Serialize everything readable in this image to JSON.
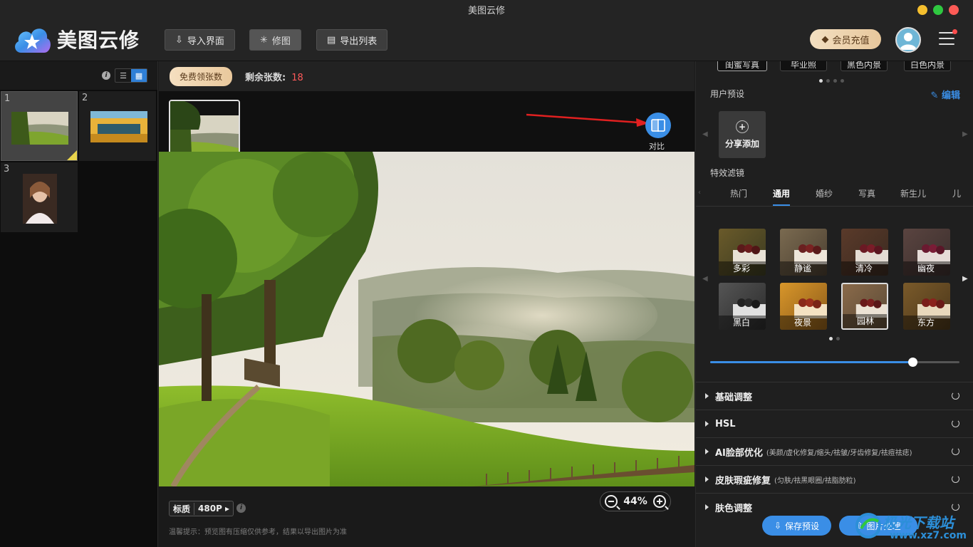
{
  "window": {
    "title": "美图云修"
  },
  "brand": {
    "name": "美图云修"
  },
  "toolbar": {
    "import_label": "导入界面",
    "retouch_label": "修图",
    "export_label": "导出列表"
  },
  "header": {
    "vip_label": "会员充值"
  },
  "sidebar": {
    "thumbnails": [
      {
        "num": "1"
      },
      {
        "num": "2"
      },
      {
        "num": "3"
      }
    ]
  },
  "center": {
    "free_label": "免费领张数",
    "remain_label": "剩余张数:",
    "remain_count": "18",
    "compare_label": "对比",
    "quality_label": "标质",
    "quality_value": "480P ▸",
    "tip": "温馨提示：预览图有压缩仅供参考，结果以导出图片为准",
    "zoom": "44%"
  },
  "presets": {
    "top_chips": [
      "闺蜜写真",
      "毕业照",
      "黑色内景",
      "白色内景"
    ],
    "user_preset_label": "用户预设",
    "edit_label": "编辑",
    "share_add_label": "分享添加",
    "effects_label": "特效滤镜"
  },
  "filter_tabs": [
    "热门",
    "通用",
    "婚纱",
    "写真",
    "新生儿",
    "儿"
  ],
  "filters": [
    {
      "label": "多彩"
    },
    {
      "label": "静谧"
    },
    {
      "label": "清冷"
    },
    {
      "label": "幽夜"
    },
    {
      "label": "黑白"
    },
    {
      "label": "夜景"
    },
    {
      "label": "园林"
    },
    {
      "label": "东方"
    }
  ],
  "slider": {
    "value": 0.81
  },
  "sections": [
    {
      "title": "基础调整",
      "sub": ""
    },
    {
      "title": "HSL",
      "sub": ""
    },
    {
      "title": "AI脸部优化",
      "sub": "(美颜/虚化修复/缩头/祛皱/牙齿修复/祛痘祛痣)"
    },
    {
      "title": "皮肤瑕疵修复",
      "sub": "(匀肤/祛黑眼圈/祛脂肪粒)"
    },
    {
      "title": "肤色调整",
      "sub": ""
    }
  ],
  "footer": {
    "save_preset_label": "保存预设",
    "process_label": "图片处理"
  },
  "watermark": {
    "text": "极光下载站",
    "url": "www.xz7.com"
  },
  "colors": {
    "accent": "#3a8ee6",
    "remain": "#ff5a5a",
    "vip": "#e9c89c"
  }
}
